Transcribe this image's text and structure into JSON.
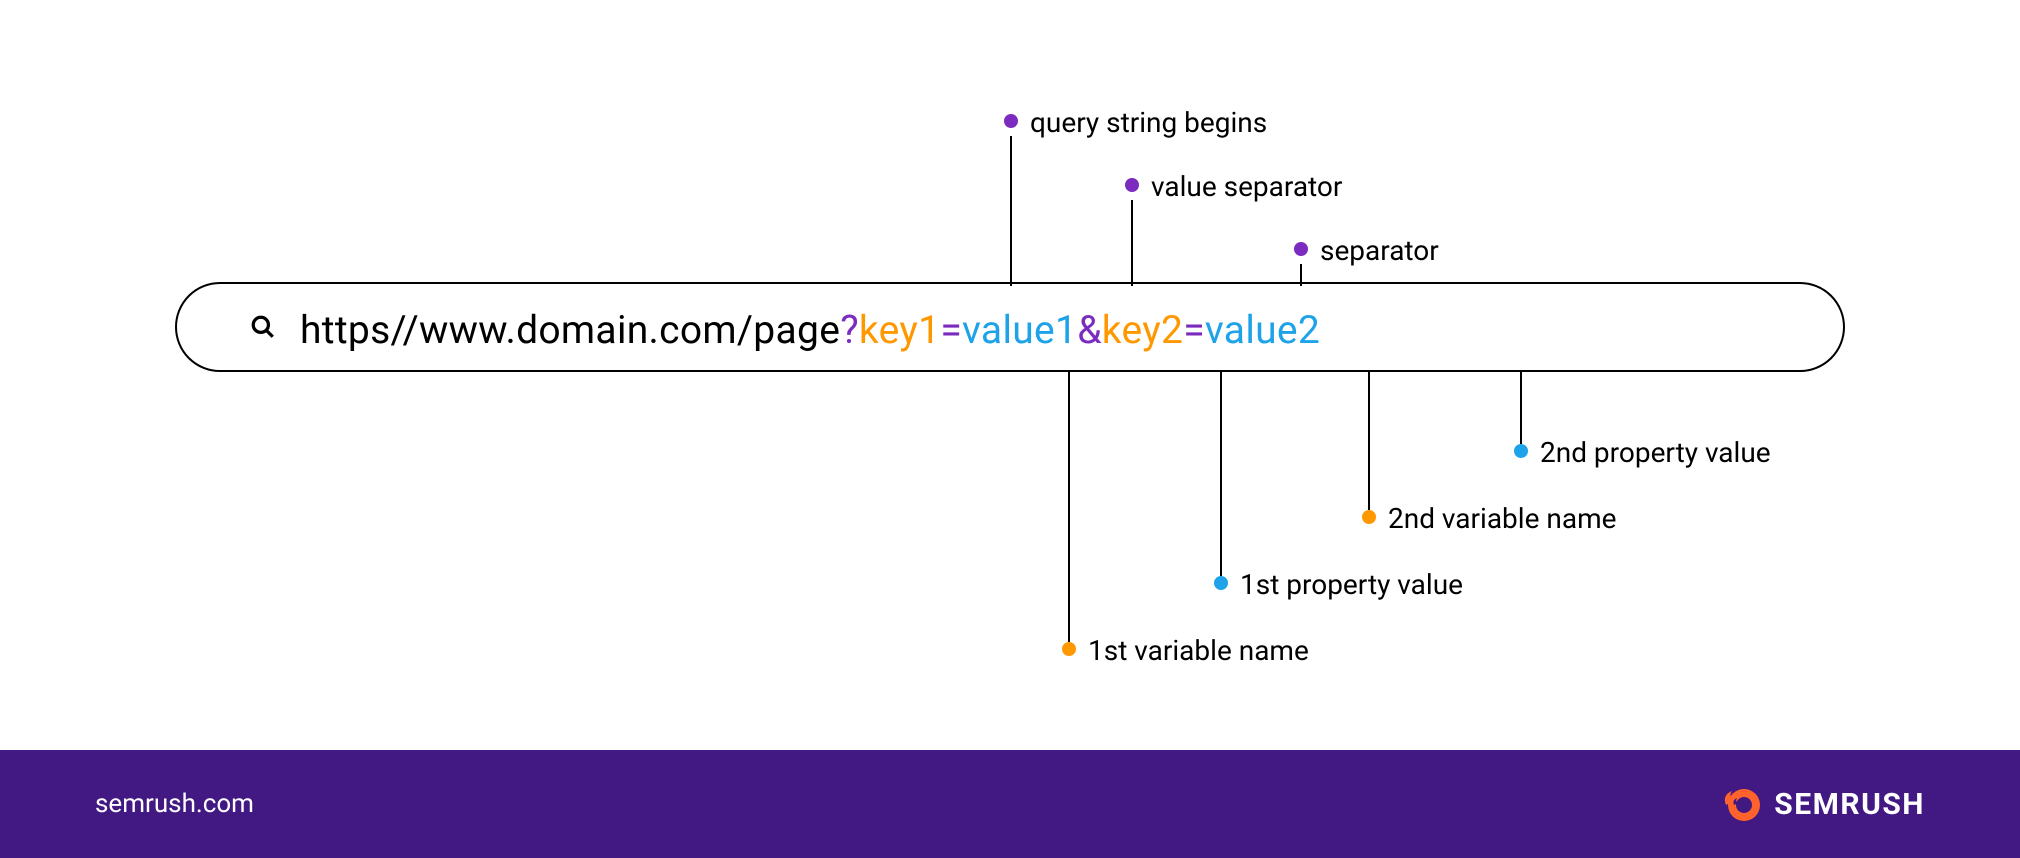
{
  "colors": {
    "purple": "#7b2cbf",
    "orange": "#ff9800",
    "blue": "#1fa3e8",
    "footer_bg": "#421983",
    "logo_accent": "#ff622d"
  },
  "url": {
    "base": "https//www.domain.com/page",
    "question": "?",
    "key1": "key1",
    "eq1": "=",
    "value1": "value1",
    "amp": "&",
    "key2": "key2",
    "eq2": "=",
    "value2": "value2"
  },
  "annotations": {
    "top": [
      {
        "label": "query string begins",
        "color": "purple"
      },
      {
        "label": "value separator",
        "color": "purple"
      },
      {
        "label": "separator",
        "color": "purple"
      }
    ],
    "bottom": [
      {
        "label": "1st variable name",
        "color": "orange"
      },
      {
        "label": "1st property value",
        "color": "blue"
      },
      {
        "label": "2nd variable name",
        "color": "orange"
      },
      {
        "label": "2nd property value",
        "color": "blue"
      }
    ]
  },
  "footer": {
    "site": "semrush.com",
    "brand": "SEMRUSH"
  }
}
